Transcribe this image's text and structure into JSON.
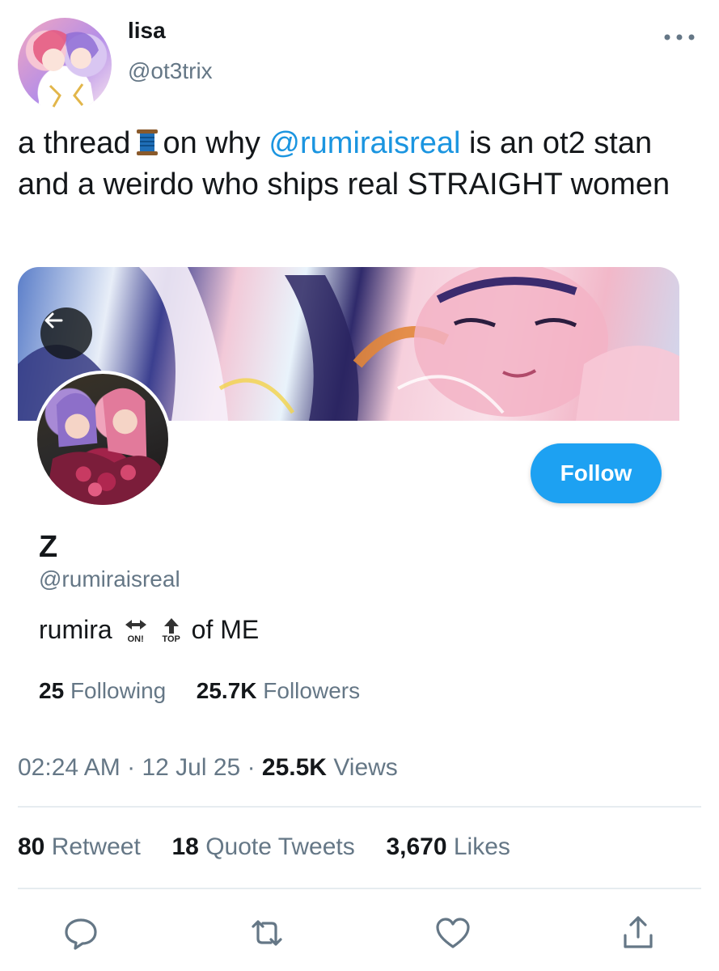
{
  "author": {
    "name": "lisa",
    "handle": "@ot3trix",
    "avatar_icon": "anime-illustration-avatar"
  },
  "tweet": {
    "text_part1": "a thread",
    "spool_icon": "spool-of-thread-emoji",
    "text_part2": "on why",
    "mention": "@rumiraisreal",
    "text_part3": "is an ot2 stan and a weirdo who ships real STRAIGHT women"
  },
  "profile_card": {
    "back_icon": "arrow-left-icon",
    "follow_label": "Follow",
    "name": "Z",
    "handle": "@rumiraisreal",
    "bio_word": "rumira",
    "bio_emoji_1_label": "ON!",
    "bio_emoji_2_label": "TOP",
    "bio_tail": "of ME",
    "following_count": "25",
    "following_label": "Following",
    "followers_count": "25.7K",
    "followers_label": "Followers"
  },
  "meta": {
    "time": "02:24 AM",
    "separator": "·",
    "date": "12 Jul 25",
    "views_count": "25.5K",
    "views_label": "Views"
  },
  "engagement": {
    "retweets_count": "80",
    "retweets_label": "Retweet",
    "quotes_count": "18",
    "quotes_label": "Quote Tweets",
    "likes_count": "3,670",
    "likes_label": "Likes"
  },
  "actions": [
    "reply-icon",
    "retweet-icon",
    "like-icon",
    "share-icon"
  ],
  "colors": {
    "accent": "#1da1f2",
    "mention": "#1b95e0",
    "secondary_text": "#657786",
    "primary_text": "#14171a"
  }
}
